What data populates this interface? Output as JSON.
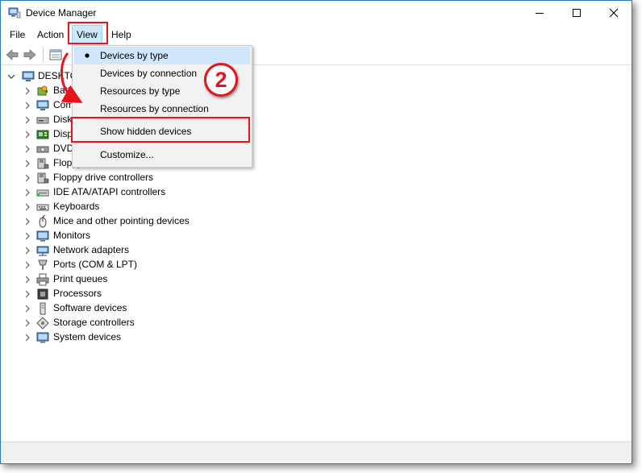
{
  "window": {
    "title": "Device Manager"
  },
  "menubar": {
    "items": [
      {
        "label": "File"
      },
      {
        "label": "Action"
      },
      {
        "label": "View"
      },
      {
        "label": "Help"
      }
    ]
  },
  "tree": {
    "root": "DESKTO",
    "items": [
      {
        "label": "Batt",
        "icon": "battery-icon"
      },
      {
        "label": "Com",
        "icon": "computer-icon"
      },
      {
        "label": "Disk",
        "icon": "disk-drive-icon"
      },
      {
        "label": "Disp",
        "icon": "display-adapter-icon"
      },
      {
        "label": "DVD",
        "icon": "dvd-drive-icon"
      },
      {
        "label": "Floppy disk drives",
        "icon": "floppy-disk-icon"
      },
      {
        "label": "Floppy drive controllers",
        "icon": "floppy-controller-icon"
      },
      {
        "label": "IDE ATA/ATAPI controllers",
        "icon": "ide-controller-icon"
      },
      {
        "label": "Keyboards",
        "icon": "keyboard-icon"
      },
      {
        "label": "Mice and other pointing devices",
        "icon": "mouse-icon"
      },
      {
        "label": "Monitors",
        "icon": "monitor-icon"
      },
      {
        "label": "Network adapters",
        "icon": "network-adapter-icon"
      },
      {
        "label": "Ports (COM & LPT)",
        "icon": "port-icon"
      },
      {
        "label": "Print queues",
        "icon": "printer-icon"
      },
      {
        "label": "Processors",
        "icon": "processor-icon"
      },
      {
        "label": "Software devices",
        "icon": "software-device-icon"
      },
      {
        "label": "Storage controllers",
        "icon": "storage-controller-icon"
      },
      {
        "label": "System devices",
        "icon": "system-device-icon"
      }
    ]
  },
  "view_menu": {
    "items": [
      {
        "label": "Devices by type",
        "checked": true
      },
      {
        "label": "Devices by connection"
      },
      {
        "label": "Resources by type"
      },
      {
        "label": "Resources by connection"
      },
      {
        "label": "Show hidden devices"
      },
      {
        "label": "Customize..."
      }
    ]
  },
  "annotation": {
    "step_number": "2"
  },
  "colors": {
    "highlight_red": "#e8141b",
    "menu_active": "#cce8ff",
    "menu_checked": "#cfe6fb"
  }
}
